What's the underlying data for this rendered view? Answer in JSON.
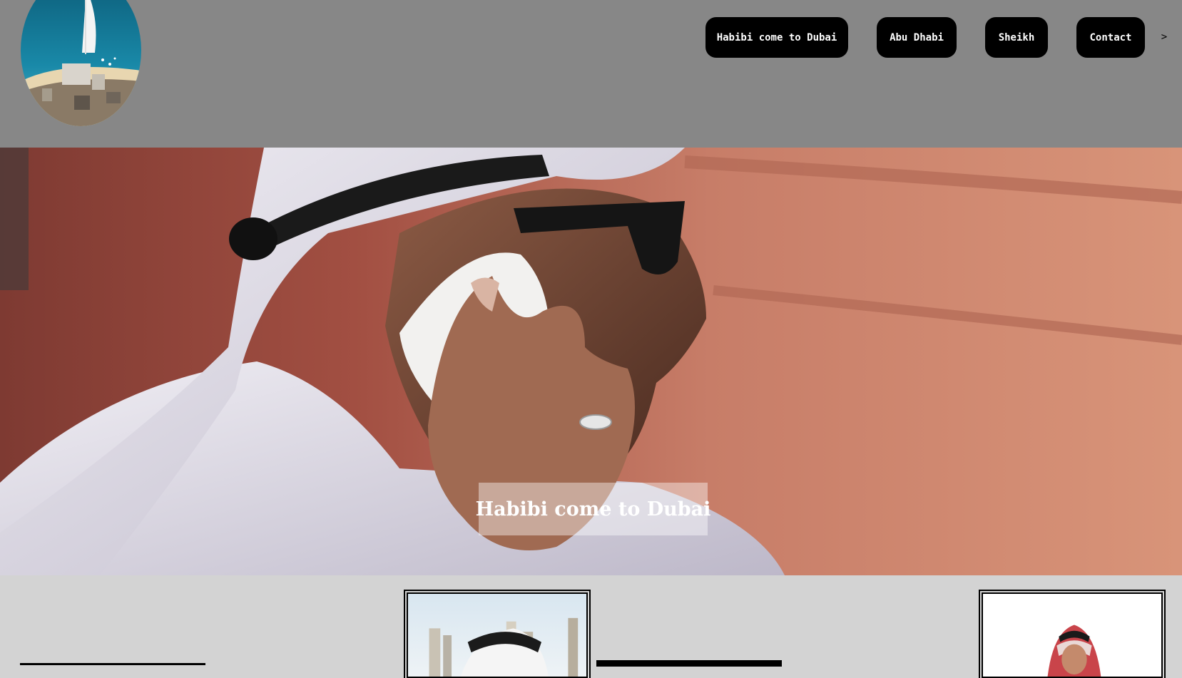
{
  "header": {
    "logo_icon": "burj-al-arab-logo-icon",
    "nav": [
      {
        "label": "Habibi come to Dubai"
      },
      {
        "label": "Abu Dhabi"
      },
      {
        "label": "Sheikh"
      },
      {
        "label": "Contact"
      }
    ],
    "more_label": ">"
  },
  "hero": {
    "title": "Habibi come to Dubai",
    "image_icon": "man-in-ghutra-on-phone-photo"
  },
  "cards": [
    {
      "image_icon": "man-in-ghutra-city-photo"
    },
    {
      "image_icon": "man-in-red-keffiyeh-photo"
    }
  ],
  "colors": {
    "header_bg": "#878787",
    "page_bg": "#d3d3d3",
    "button_bg": "#000000",
    "button_text": "#ffffff"
  }
}
